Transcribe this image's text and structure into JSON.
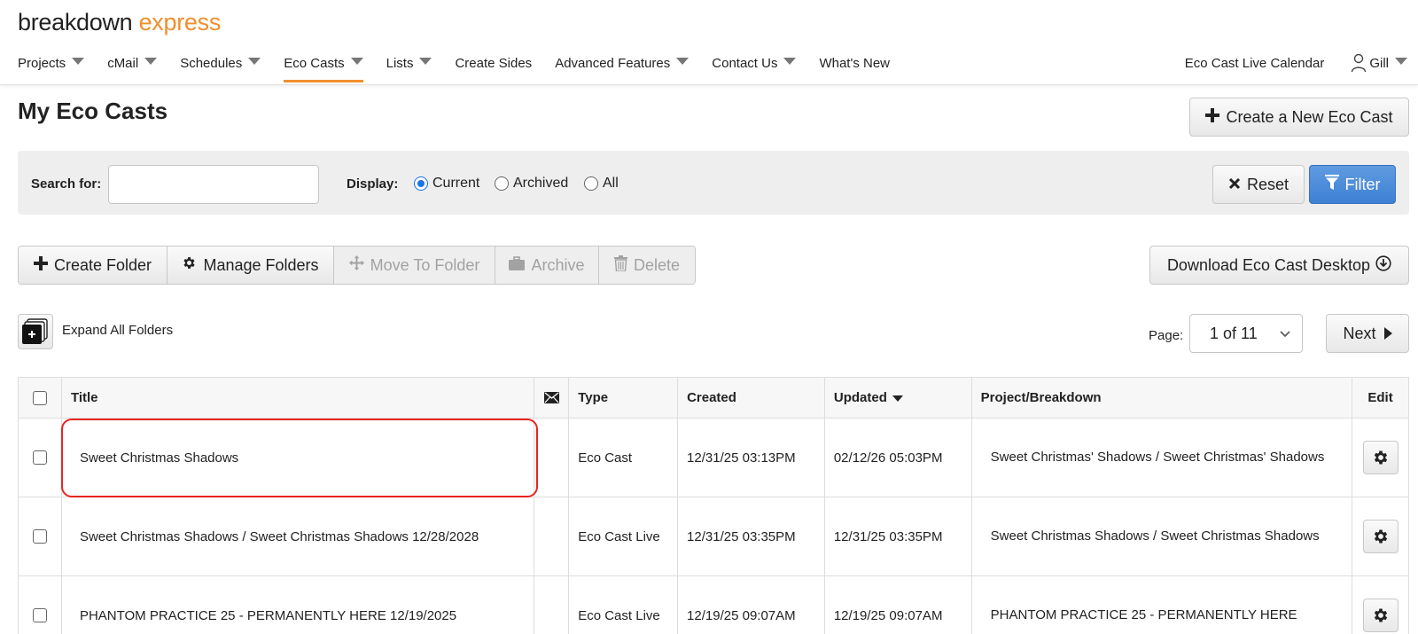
{
  "brand": {
    "part1": "breakdown",
    "part2": "express"
  },
  "nav": {
    "items": [
      {
        "label": "Projects",
        "dropdown": true
      },
      {
        "label": "cMail",
        "dropdown": true
      },
      {
        "label": "Schedules",
        "dropdown": true
      },
      {
        "label": "Eco Casts",
        "dropdown": true,
        "active": true
      },
      {
        "label": "Lists",
        "dropdown": true
      },
      {
        "label": "Create Sides",
        "dropdown": false
      },
      {
        "label": "Advanced Features",
        "dropdown": true
      },
      {
        "label": "Contact Us",
        "dropdown": true
      },
      {
        "label": "What's New",
        "dropdown": false
      }
    ],
    "calendar_label": "Eco Cast Live Calendar",
    "user_name": "Gill"
  },
  "page": {
    "title": "My Eco Casts",
    "create_button": "Create a New Eco Cast"
  },
  "filter": {
    "search_label": "Search for:",
    "search_value": "",
    "display_label": "Display:",
    "options": [
      "Current",
      "Archived",
      "All"
    ],
    "selected": "Current",
    "reset_label": "Reset",
    "filter_label": "Filter"
  },
  "toolbar": {
    "create_folder": "Create Folder",
    "manage_folders": "Manage Folders",
    "move_to_folder": "Move To Folder",
    "archive": "Archive",
    "delete": "Delete",
    "download": "Download Eco Cast Desktop"
  },
  "pager": {
    "expand_all": "Expand All Folders",
    "page_label": "Page:",
    "page_value": "1 of 11",
    "next_label": "Next"
  },
  "table": {
    "headers": {
      "title": "Title",
      "type": "Type",
      "created": "Created",
      "updated": "Updated",
      "project": "Project/Breakdown",
      "edit": "Edit"
    },
    "rows": [
      {
        "title": "Sweet Christmas Shadows",
        "type": "Eco Cast",
        "created": "12/31/25 03:13PM",
        "updated": "02/12/26 05:03PM",
        "project": "Sweet Christmas' Shadows / Sweet Christmas' Shadows"
      },
      {
        "title": "Sweet Christmas Shadows / Sweet Christmas Shadows 12/28/2028",
        "type": "Eco Cast Live",
        "created": "12/31/25 03:35PM",
        "updated": "12/31/25 03:35PM",
        "project": "Sweet Christmas Shadows / Sweet Christmas Shadows"
      },
      {
        "title": "PHANTOM PRACTICE 25 - PERMANENTLY HERE 12/19/2025",
        "type": "Eco Cast Live",
        "created": "12/19/25 09:07AM",
        "updated": "12/19/25 09:07AM",
        "project": "PHANTOM PRACTICE 25 - PERMANENTLY HERE"
      }
    ]
  },
  "colors": {
    "accent": "#ef8f2d",
    "primary": "#3f80d4",
    "highlight": "#e8241f"
  }
}
